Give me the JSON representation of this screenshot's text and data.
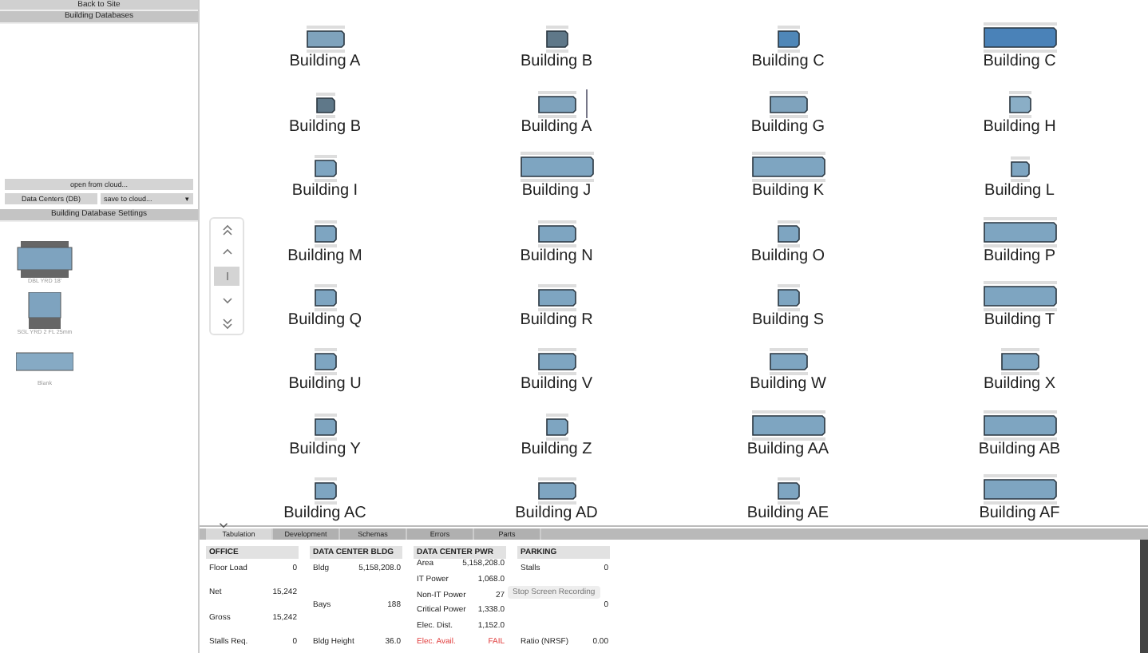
{
  "sidebar": {
    "back_button": "Back to Site",
    "section_title": "Building Databases",
    "open_button": "open from cloud...",
    "database_button": "Data Centers (DB)",
    "save_dropdown": "save to cloud...",
    "dropdown_arrow": "▾",
    "settings_title": "Building Database Settings",
    "templates": [
      {
        "label": "DBL YRD 18'",
        "kind": "double"
      },
      {
        "label": "SGL YRD 2 FL 25mm",
        "kind": "single"
      },
      {
        "label": "Blank",
        "kind": "blank"
      }
    ]
  },
  "buildings": [
    {
      "label": "Building A",
      "kind": "medium",
      "color": "#7fa3bd",
      "selected": false
    },
    {
      "label": "Building B",
      "kind": "square",
      "color": "#5f7889",
      "selected": false
    },
    {
      "label": "Building C",
      "kind": "square",
      "color": "#4f87b8",
      "selected": false
    },
    {
      "label": "Building C",
      "kind": "wide",
      "color": "#4a82b8",
      "selected": false
    },
    {
      "label": "Building B",
      "kind": "small",
      "color": "#5f7889",
      "selected": false
    },
    {
      "label": "Building A",
      "kind": "medium",
      "color": "#7fa3bd",
      "selected": true
    },
    {
      "label": "Building G",
      "kind": "medium",
      "color": "#7fa3bd",
      "selected": false
    },
    {
      "label": "Building H",
      "kind": "square",
      "color": "#8aaec6",
      "selected": false
    },
    {
      "label": "Building I",
      "kind": "square",
      "color": "#7ea5c1",
      "selected": false
    },
    {
      "label": "Building J",
      "kind": "wide",
      "color": "#7ea5c1",
      "selected": false
    },
    {
      "label": "Building K",
      "kind": "wide",
      "color": "#7ea5c1",
      "selected": false
    },
    {
      "label": "Building L",
      "kind": "small",
      "color": "#7ea5c1",
      "selected": false
    },
    {
      "label": "Building M",
      "kind": "square",
      "color": "#7ea5c1",
      "selected": false
    },
    {
      "label": "Building N",
      "kind": "medium",
      "color": "#7ea5c1",
      "selected": false
    },
    {
      "label": "Building O",
      "kind": "square",
      "color": "#7ea5c1",
      "selected": false
    },
    {
      "label": "Building P",
      "kind": "wide",
      "color": "#7ea5c1",
      "selected": false
    },
    {
      "label": "Building Q",
      "kind": "square",
      "color": "#7ea5c1",
      "selected": false
    },
    {
      "label": "Building R",
      "kind": "medium",
      "color": "#7ea5c1",
      "selected": false
    },
    {
      "label": "Building S",
      "kind": "square",
      "color": "#7ea5c1",
      "selected": false
    },
    {
      "label": "Building T",
      "kind": "wide",
      "color": "#7ea5c1",
      "selected": false
    },
    {
      "label": "Building U",
      "kind": "square",
      "color": "#7ea5c1",
      "selected": false
    },
    {
      "label": "Building V",
      "kind": "medium",
      "color": "#7ea5c1",
      "selected": false
    },
    {
      "label": "Building W",
      "kind": "medium",
      "color": "#7ea5c1",
      "selected": false
    },
    {
      "label": "Building X",
      "kind": "medium",
      "color": "#7ea5c1",
      "selected": false
    },
    {
      "label": "Building Y",
      "kind": "square",
      "color": "#7ea5c1",
      "selected": false
    },
    {
      "label": "Building Z",
      "kind": "square",
      "color": "#7ea5c1",
      "selected": false
    },
    {
      "label": "Building AA",
      "kind": "wide",
      "color": "#7ea5c1",
      "selected": false
    },
    {
      "label": "Building AB",
      "kind": "wide",
      "color": "#7ea5c1",
      "selected": false
    },
    {
      "label": "Building AC",
      "kind": "square",
      "color": "#7ea5c1",
      "selected": false
    },
    {
      "label": "Building AD",
      "kind": "medium",
      "color": "#7ea5c1",
      "selected": false
    },
    {
      "label": "Building AE",
      "kind": "square",
      "color": "#7ea5c1",
      "selected": false
    },
    {
      "label": "Building AF",
      "kind": "wide",
      "color": "#7ea5c1",
      "selected": false
    }
  ],
  "nav_controls": [
    {
      "kind": "top",
      "selected": false
    },
    {
      "kind": "up",
      "selected": false
    },
    {
      "kind": "middle",
      "selected": true
    },
    {
      "kind": "down",
      "selected": false
    },
    {
      "kind": "bottom",
      "selected": false
    }
  ],
  "tabs": [
    {
      "label": "Tabulation",
      "selected": true
    },
    {
      "label": "Development",
      "selected": false
    },
    {
      "label": "Schemas",
      "selected": false
    },
    {
      "label": "Errors",
      "selected": false
    },
    {
      "label": "Parts",
      "selected": false
    }
  ],
  "cards": [
    {
      "title": "OFFICE",
      "rows": [
        {
          "label": "Floor Load",
          "value": "0",
          "alert": false
        },
        {
          "label": "Net",
          "value": "15,242",
          "alert": false
        },
        {
          "label": "Gross",
          "value": "15,242",
          "alert": false
        },
        {
          "label": "Stalls Req.",
          "value": "0",
          "alert": false
        }
      ]
    },
    {
      "title": "DATA CENTER BLDG",
      "rows": [
        {
          "label": "Bldg",
          "value": "5,158,208.0",
          "alert": false
        },
        {
          "label": "Bays",
          "value": "188",
          "alert": false
        },
        {
          "label": "Bldg Height",
          "value": "36.0",
          "alert": false
        }
      ]
    },
    {
      "title": "DATA CENTER PWR",
      "rows": [
        {
          "label": "Area",
          "value": "5,158,208.0",
          "alert": false
        },
        {
          "label": "IT Power",
          "value": "1,068.0",
          "alert": false
        },
        {
          "label": "Non-IT Power",
          "value": "27",
          "alert": false
        },
        {
          "label": "Critical Power",
          "value": "1,338.0",
          "alert": false
        },
        {
          "label": "Elec. Dist.",
          "value": "1,152.0",
          "alert": false
        },
        {
          "label": "Elec. Avail.",
          "value": "FAIL",
          "alert": true
        }
      ]
    },
    {
      "title": "PARKING",
      "rows": [
        {
          "label": "Stalls",
          "value": "0",
          "alert": false
        },
        {
          "value": "0",
          "alert": false
        },
        {
          "label": "Ratio (NRSF)",
          "value": "0.00",
          "alert": false
        }
      ]
    }
  ],
  "tooltip": "Stop Screen Recording"
}
